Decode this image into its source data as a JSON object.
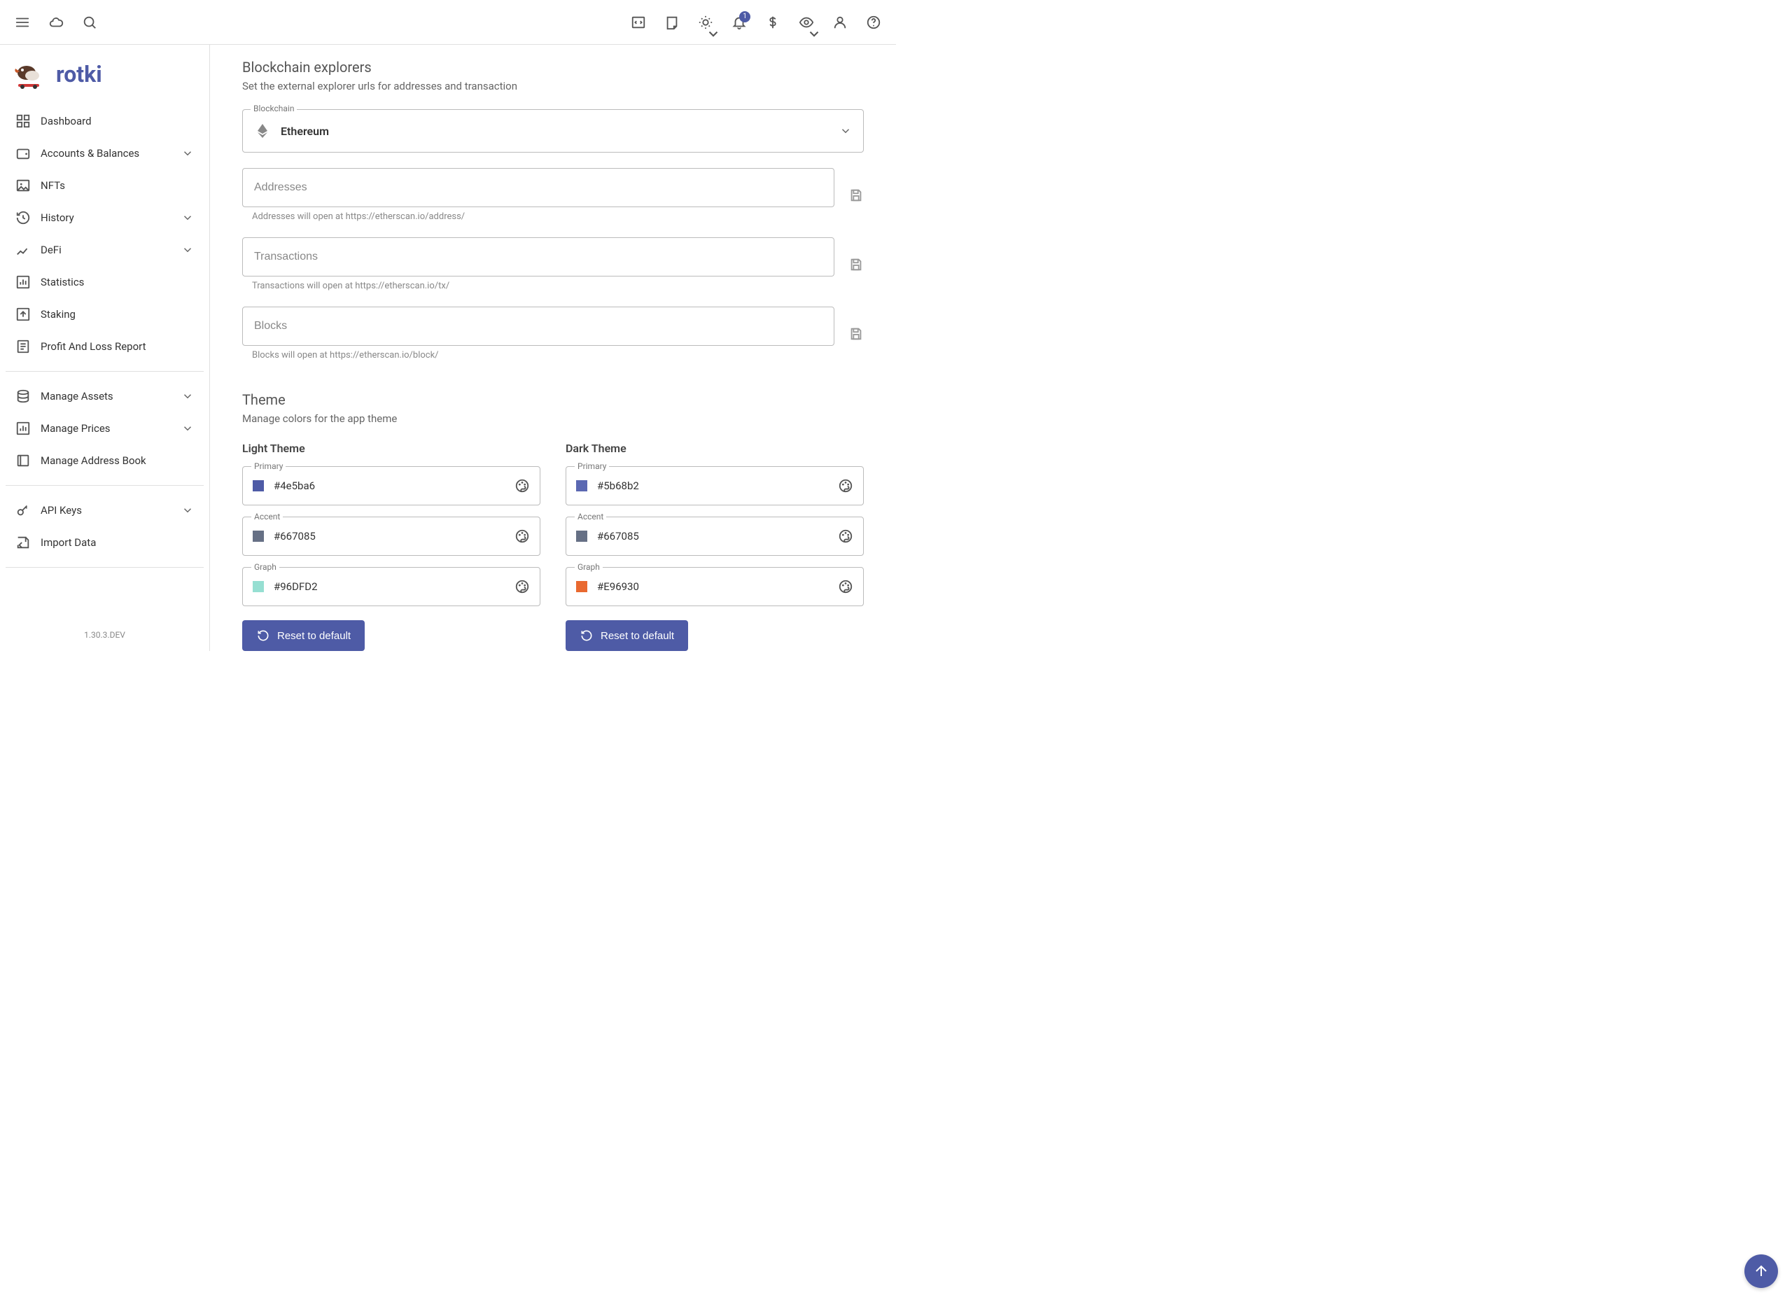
{
  "app": {
    "name": "rotki",
    "version": "1.30.3.DEV"
  },
  "topbar": {
    "notification_count": "1"
  },
  "sidebar": {
    "items": [
      {
        "label": "Dashboard",
        "expandable": false
      },
      {
        "label": "Accounts & Balances",
        "expandable": true
      },
      {
        "label": "NFTs",
        "expandable": false
      },
      {
        "label": "History",
        "expandable": true
      },
      {
        "label": "DeFi",
        "expandable": true
      },
      {
        "label": "Statistics",
        "expandable": false
      },
      {
        "label": "Staking",
        "expandable": false
      },
      {
        "label": "Profit And Loss Report",
        "expandable": false
      }
    ],
    "bottom_items": [
      {
        "label": "Manage Assets",
        "expandable": true
      },
      {
        "label": "Manage Prices",
        "expandable": true
      },
      {
        "label": "Manage Address Book",
        "expandable": false
      }
    ],
    "third_items": [
      {
        "label": "API Keys",
        "expandable": true
      },
      {
        "label": "Import Data",
        "expandable": false
      }
    ]
  },
  "explorers": {
    "title": "Blockchain explorers",
    "subtitle": "Set the external explorer urls for addresses and transaction",
    "blockchain_label": "Blockchain",
    "blockchain_value": "Ethereum",
    "fields": [
      {
        "placeholder": "Addresses",
        "hint": "Addresses will open at https://etherscan.io/address/"
      },
      {
        "placeholder": "Transactions",
        "hint": "Transactions will open at https://etherscan.io/tx/"
      },
      {
        "placeholder": "Blocks",
        "hint": "Blocks will open at https://etherscan.io/block/"
      }
    ]
  },
  "theme": {
    "title": "Theme",
    "subtitle": "Manage colors for the app theme",
    "light_title": "Light Theme",
    "dark_title": "Dark Theme",
    "reset_label": "Reset to default",
    "light": [
      {
        "label": "Primary",
        "value": "#4e5ba6",
        "color": "#4e5ba6"
      },
      {
        "label": "Accent",
        "value": "#667085",
        "color": "#667085"
      },
      {
        "label": "Graph",
        "value": "#96DFD2",
        "color": "#96DFD2"
      }
    ],
    "dark": [
      {
        "label": "Primary",
        "value": "#5b68b2",
        "color": "#5b68b2"
      },
      {
        "label": "Accent",
        "value": "#667085",
        "color": "#667085"
      },
      {
        "label": "Graph",
        "value": "#E96930",
        "color": "#E96930"
      }
    ]
  }
}
